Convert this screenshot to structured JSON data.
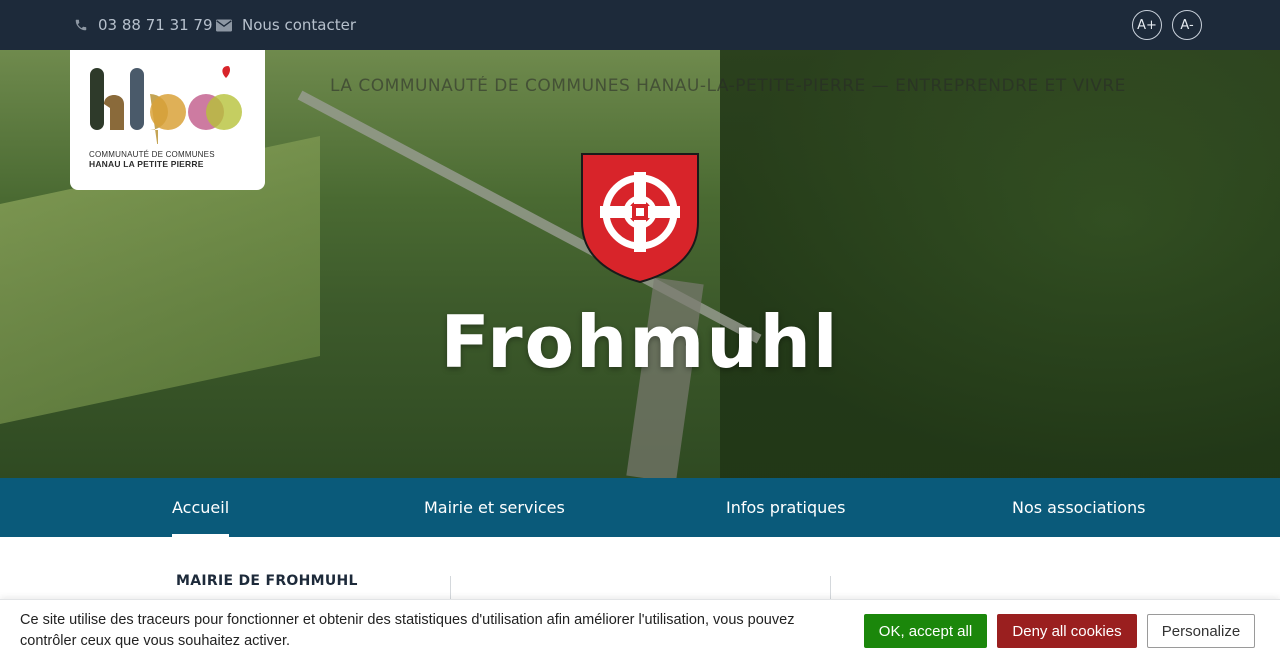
{
  "topbar": {
    "phone": "03 88 71 31 79",
    "contact_label": "Nous contacter",
    "font_increase": "A+",
    "font_decrease": "A-",
    "background_color": "#1d2a3a"
  },
  "logo": {
    "line1": "COMMUNAUTÉ DE COMMUNES",
    "line2": "HANAU LA PETITE PIERRE"
  },
  "hero": {
    "tagline": "LA COMMUNAUTÉ DE COMMUNES HANAU-LA-PETITE-PIERRE — ENTREPRENDRE ET VIVRE",
    "town_name": "Frohmuhl"
  },
  "nav": {
    "items": [
      {
        "label": "Accueil",
        "active": true
      },
      {
        "label": "Mairie et services",
        "active": false
      },
      {
        "label": "Infos pratiques",
        "active": false
      },
      {
        "label": "Nos associations",
        "active": false
      }
    ],
    "background_color": "#0a5a7a"
  },
  "content": {
    "section_title": "MAIRIE DE FROHMUHL"
  },
  "cookie_banner": {
    "message": "Ce site utilise des traceurs pour fonctionner et obtenir des statistiques d'utilisation afin améliorer l'utilisation, vous pouvez contrôler ceux que vous souhaitez activer.",
    "accept_label": "OK, accept all",
    "deny_label": "Deny all cookies",
    "personalize_label": "Personalize",
    "accept_color": "#1b870b",
    "deny_color": "#9a1f1f"
  }
}
